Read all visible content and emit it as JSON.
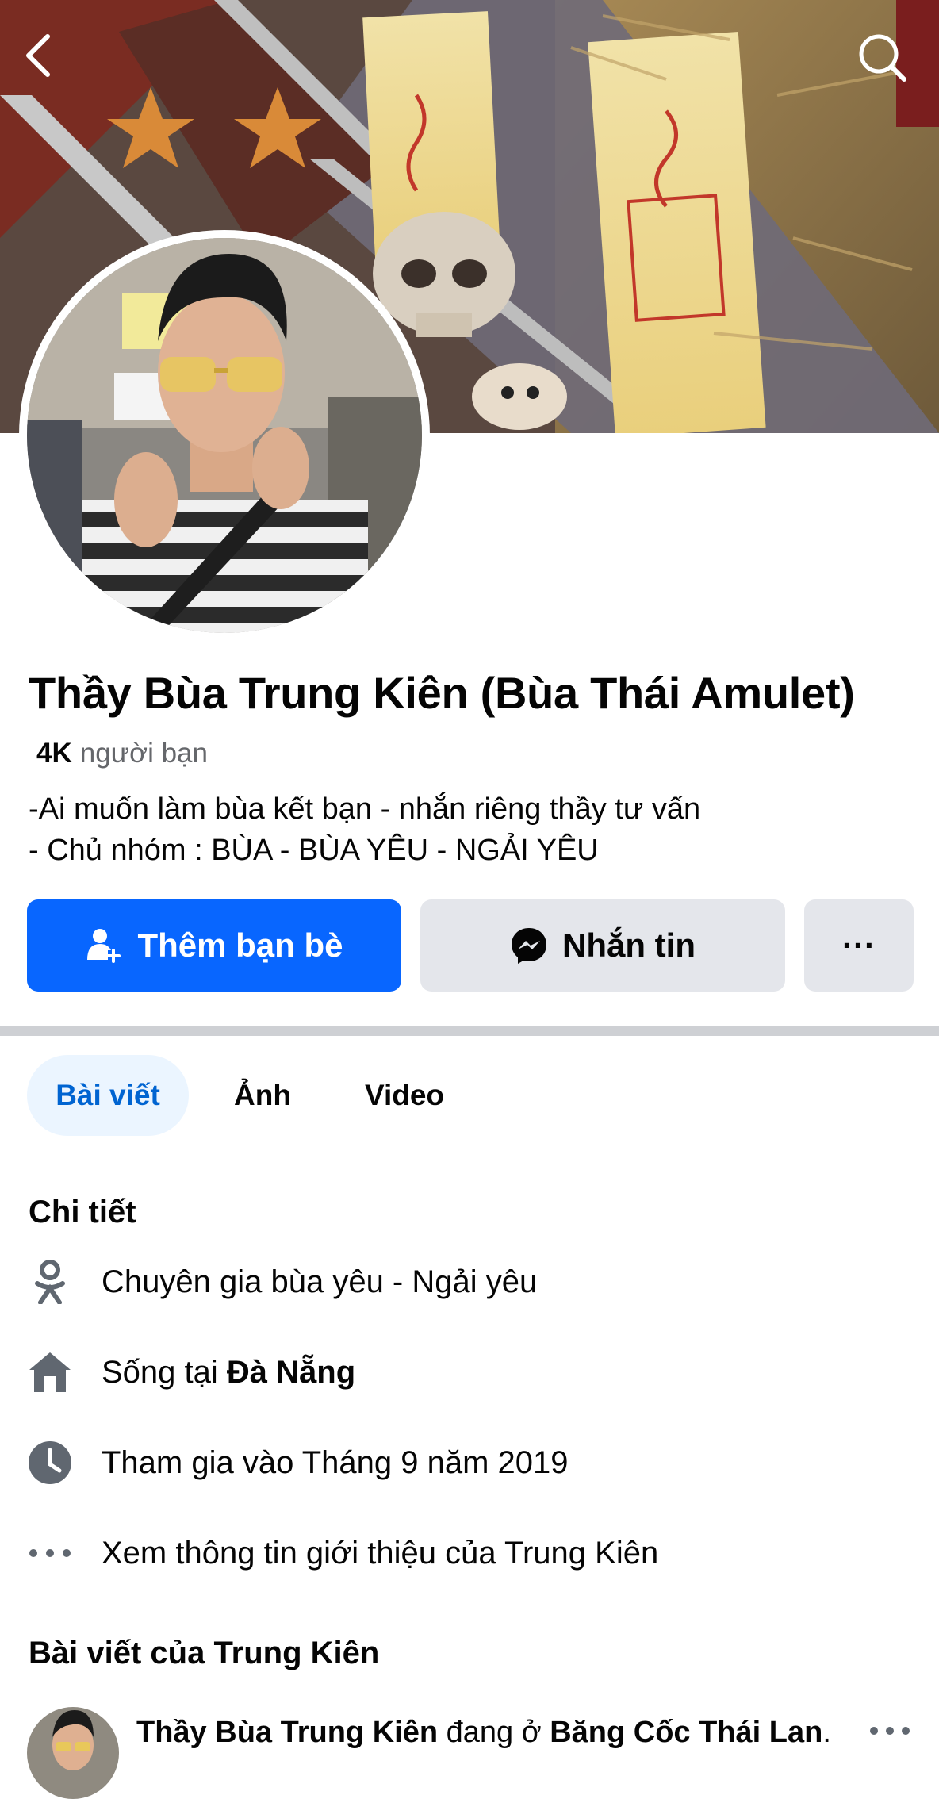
{
  "nav": {
    "back_icon": "chevron-left-icon",
    "search_icon": "search-icon"
  },
  "profile": {
    "name": "Thầy Bùa Trung Kiên (Bùa Thái Amulet)",
    "friends_count": "4K",
    "friends_label": "người bạn",
    "bio_line_1": "-Ai muốn làm bùa kết bạn - nhắn riêng thầy tư vấn",
    "bio_line_2": "- Chủ nhóm : BÙA - BÙA YÊU - NGẢI YÊU"
  },
  "actions": {
    "add_friend_label": "Thêm bạn bè",
    "message_label": "Nhắn tin",
    "more_label": "···"
  },
  "tabs": [
    {
      "label": "Bài viết",
      "active": true
    },
    {
      "label": "Ảnh",
      "active": false
    },
    {
      "label": "Video",
      "active": false
    }
  ],
  "details": {
    "title": "Chi tiết",
    "items": [
      {
        "icon": "job-icon",
        "text": "Chuyên gia bùa yêu - Ngải yêu"
      },
      {
        "icon": "home-icon",
        "prefix": "Sống tại ",
        "bold": "Đà Nẵng"
      },
      {
        "icon": "clock-icon",
        "text": "Tham gia vào Tháng 9 năm 2019"
      },
      {
        "icon": "more-dots-icon",
        "text": "Xem thông tin giới thiệu của Trung Kiên"
      }
    ]
  },
  "posts": {
    "title": "Bài viết của Trung Kiên",
    "first": {
      "author": "Thầy Bùa Trung Kiên",
      "middle": " đang ở ",
      "place": "Băng Cốc Thái Lan",
      "end": ".",
      "more_label": "···"
    }
  },
  "colors": {
    "primary": "#0866ff",
    "secondary_button": "#e4e6eb",
    "active_tab_bg": "#ebf5ff",
    "active_tab_text": "#0064d1",
    "icon_gray": "#606770",
    "divider": "#ced0d4"
  }
}
